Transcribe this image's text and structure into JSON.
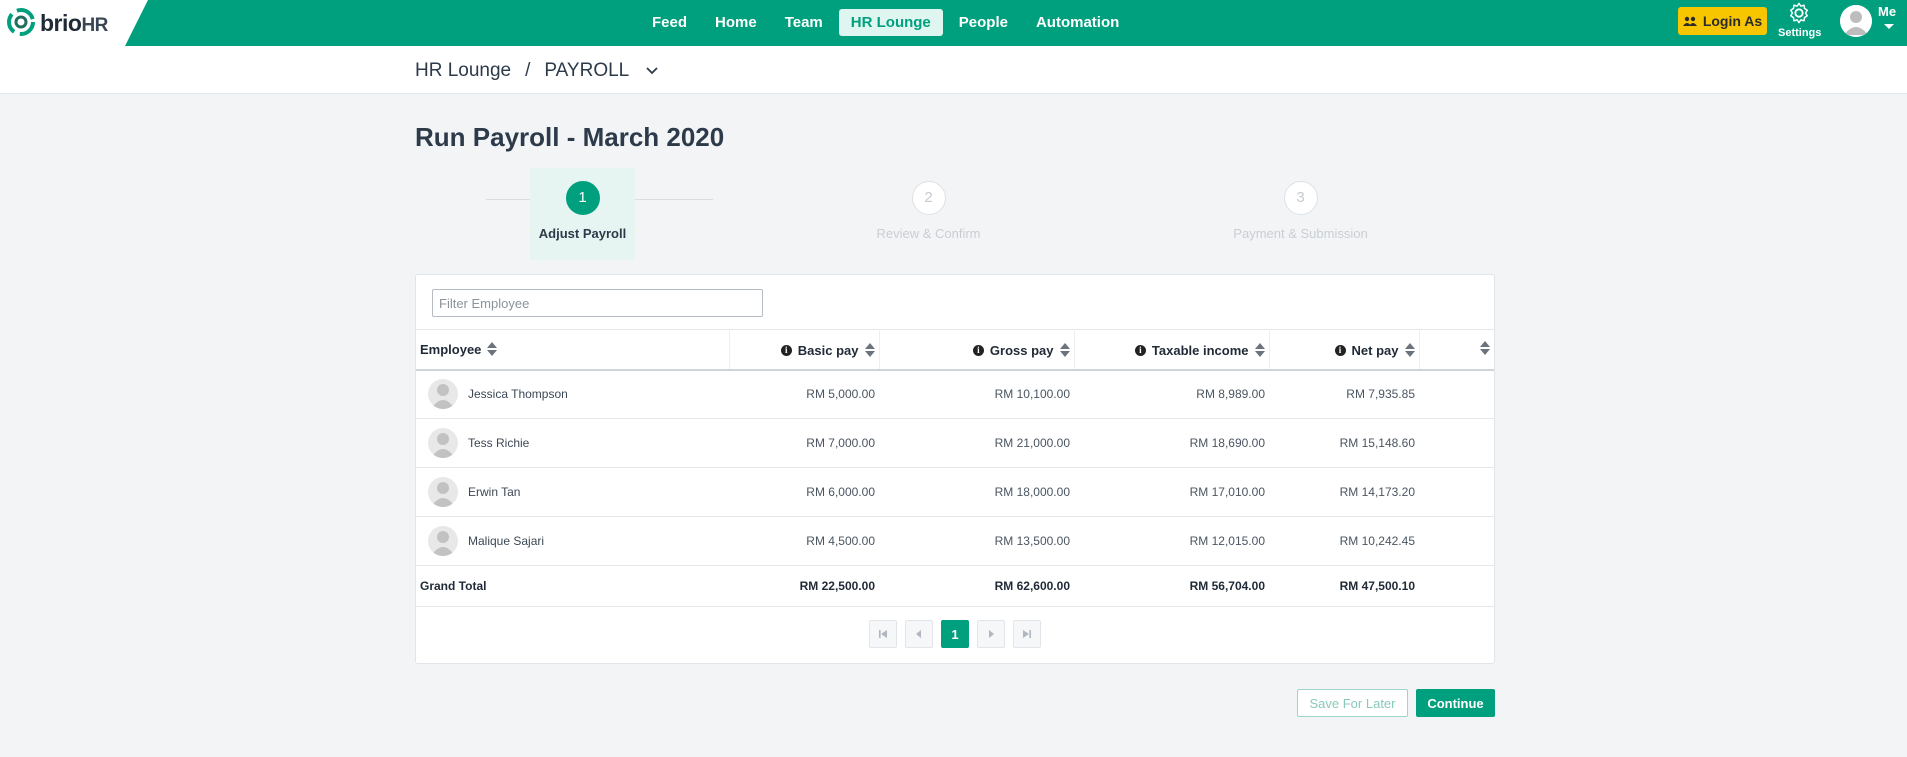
{
  "brand": {
    "name": "brio",
    "suffix": "HR",
    "color": "#00a07e"
  },
  "nav": {
    "items": [
      {
        "label": "Feed",
        "active": false
      },
      {
        "label": "Home",
        "active": false
      },
      {
        "label": "Team",
        "active": false
      },
      {
        "label": "HR Lounge",
        "active": true
      },
      {
        "label": "People",
        "active": false
      },
      {
        "label": "Automation",
        "active": false
      }
    ],
    "login_as": "Login As",
    "settings": "Settings",
    "me": "Me"
  },
  "breadcrumb": {
    "parent": "HR Lounge",
    "separator": "/",
    "current": "PAYROLL"
  },
  "page_title": "Run Payroll - March 2020",
  "steps": [
    {
      "number": "1",
      "label": "Adjust Payroll",
      "active": true
    },
    {
      "number": "2",
      "label": "Review & Confirm",
      "active": false
    },
    {
      "number": "3",
      "label": "Payment & Submission",
      "active": false
    }
  ],
  "filter": {
    "placeholder": "Filter Employee",
    "value": ""
  },
  "table": {
    "columns": [
      "Employee",
      "Basic pay",
      "Gross pay",
      "Taxable income",
      "Net pay"
    ],
    "rows": [
      {
        "name": "Jessica Thompson",
        "basic": "RM 5,000.00",
        "gross": "RM 10,100.00",
        "taxable": "RM 8,989.00",
        "net": "RM 7,935.85"
      },
      {
        "name": "Tess Richie",
        "basic": "RM 7,000.00",
        "gross": "RM 21,000.00",
        "taxable": "RM 18,690.00",
        "net": "RM 15,148.60"
      },
      {
        "name": "Erwin Tan",
        "basic": "RM 6,000.00",
        "gross": "RM 18,000.00",
        "taxable": "RM 17,010.00",
        "net": "RM 14,173.20"
      },
      {
        "name": "Malique Sajari",
        "basic": "RM 4,500.00",
        "gross": "RM 13,500.00",
        "taxable": "RM 12,015.00",
        "net": "RM 10,242.45"
      }
    ],
    "total": {
      "label": "Grand Total",
      "basic": "RM 22,500.00",
      "gross": "RM 62,600.00",
      "taxable": "RM 56,704.00",
      "net": "RM 47,500.10"
    }
  },
  "pagination": {
    "current_page": "1"
  },
  "actions": {
    "save_for_later": "Save For Later",
    "continue": "Continue"
  }
}
